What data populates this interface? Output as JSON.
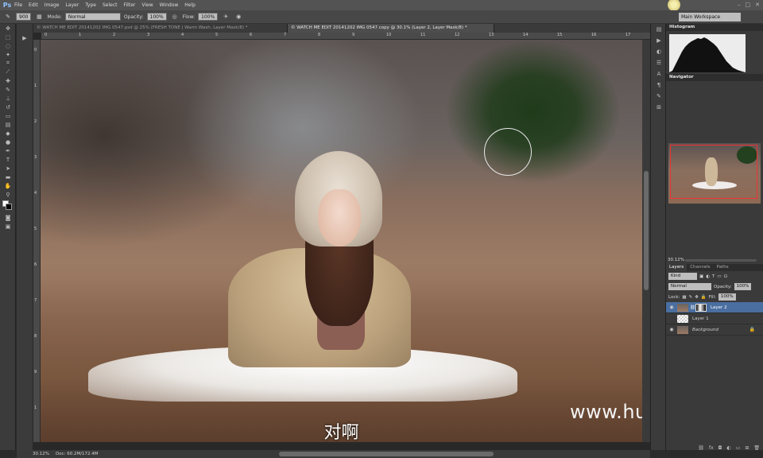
{
  "app": {
    "logo": "Ps",
    "menu": [
      "File",
      "Edit",
      "Image",
      "Layer",
      "Type",
      "Select",
      "Filter",
      "View",
      "Window",
      "Help"
    ]
  },
  "options": {
    "brush_size": "900",
    "mode_label": "Mode:",
    "mode_value": "Normal",
    "opacity_label": "Opacity:",
    "opacity_value": "100%",
    "flow_label": "Flow:",
    "flow_value": "100%",
    "workspace": "Main Workspace"
  },
  "tabs": [
    {
      "label": "© WATCH ME EDIT 20141202 IMG 0547.psd @ 25% (FRESH TONE | Warm Wash, Layer Mask/8) *",
      "active": false
    },
    {
      "label": "© WATCH ME EDIT 20141202 IMG 0547 copy @ 30.1% (Layer 2, Layer Mask/8) *",
      "active": true
    }
  ],
  "ruler": {
    "h": [
      "0",
      "1",
      "2",
      "3",
      "4",
      "5",
      "6",
      "7",
      "8",
      "9",
      "10",
      "11",
      "12",
      "13",
      "14",
      "15",
      "16",
      "17"
    ],
    "v": [
      "0",
      "1",
      "2",
      "3",
      "4",
      "5",
      "6",
      "7",
      "8",
      "9",
      "1"
    ]
  },
  "canvas": {
    "watermark": "www.hunls.com",
    "subtitle": "对啊"
  },
  "status": {
    "zoom": "30.12%",
    "doc": "Doc: 60.2M/172.4M"
  },
  "panels": {
    "histogram_title": "Histogram",
    "navigator_title": "Navigator",
    "navigator_zoom": "30.12%",
    "layers_tabs": [
      "Layers",
      "Channels",
      "Paths"
    ],
    "kind_label": "Kind",
    "blend_mode": "Normal",
    "opacity_label": "Opacity:",
    "opacity_value": "100%",
    "lock_label": "Lock:",
    "fill_label": "Fill:",
    "fill_value": "100%",
    "layers": [
      {
        "name": "Layer 2",
        "active": true
      },
      {
        "name": "Layer 1",
        "active": false
      },
      {
        "name": "Background",
        "active": false
      }
    ]
  }
}
